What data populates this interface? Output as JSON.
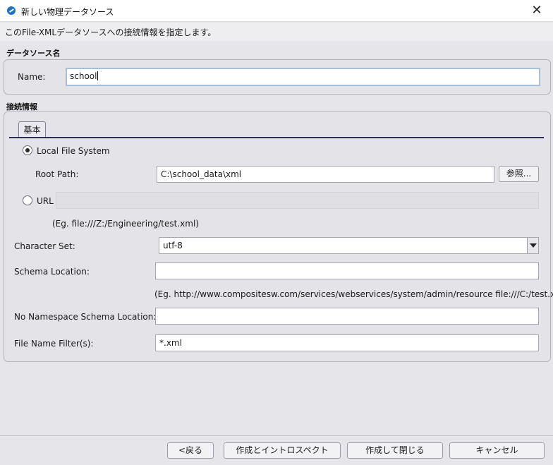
{
  "window": {
    "title": "新しい物理データソース",
    "close_glyph": "✕"
  },
  "description": "このFile-XMLデータソースへの接続情報を指定します。",
  "datasource_name": {
    "section_title": "データソース名",
    "name_label": "Name:",
    "name_value": "school"
  },
  "connection": {
    "section_title": "接続情報",
    "tabs": [
      {
        "label": "基本",
        "selected": true
      }
    ],
    "local_file_system": {
      "label": "Local File System",
      "selected": true
    },
    "root_path": {
      "label": "Root Path:",
      "value": "C:\\school_data\\xml",
      "browse_label": "参照..."
    },
    "url": {
      "label": "URL",
      "selected": false,
      "value": "",
      "example": "(Eg. file:///Z:/Engineering/test.xml)"
    },
    "character_set": {
      "label": "Character Set:",
      "value": "utf-8"
    },
    "schema_location": {
      "label": "Schema Location:",
      "value": "",
      "example": "(Eg. http://www.compositesw.com/services/webservices/system/admin/resource file:///C:/test.xsd)"
    },
    "no_namespace_schema_location": {
      "label": "No Namespace Schema Location:",
      "value": ""
    },
    "file_name_filter": {
      "label": "File Name Filter(s):",
      "value": "*.xml"
    }
  },
  "footer": {
    "back_label": "<戻る",
    "create_introspect_label": "作成とイントロスペクト",
    "create_close_label": "作成して閉じる",
    "cancel_label": "キャンセル"
  },
  "icons": {
    "app": "app-icon",
    "close": "close-icon",
    "combo": "chevron-down-icon"
  }
}
